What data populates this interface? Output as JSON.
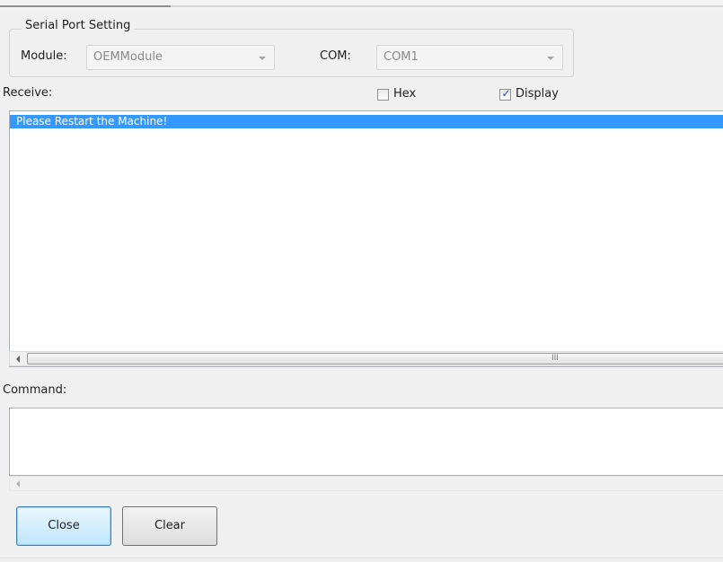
{
  "serial_port_setting": {
    "title": "Serial Port Setting",
    "module_label": "Module:",
    "module_value": "OEMModule",
    "com_label": "COM:",
    "com_value": "COM1"
  },
  "receive": {
    "label": "Receive:",
    "hex_label": "Hex",
    "hex_checked": false,
    "display_label": "Display",
    "display_checked": true,
    "lines": [
      "Please Restart the Machine!"
    ],
    "scroll_grip": "III"
  },
  "command": {
    "label": "Command:",
    "value": ""
  },
  "buttons": {
    "close_label": "Close",
    "clear_label": "Clear"
  },
  "colors": {
    "selection": "#3399ff",
    "checkmark": "#1d4aa5",
    "focused_button_border": "#3c7fb1"
  }
}
